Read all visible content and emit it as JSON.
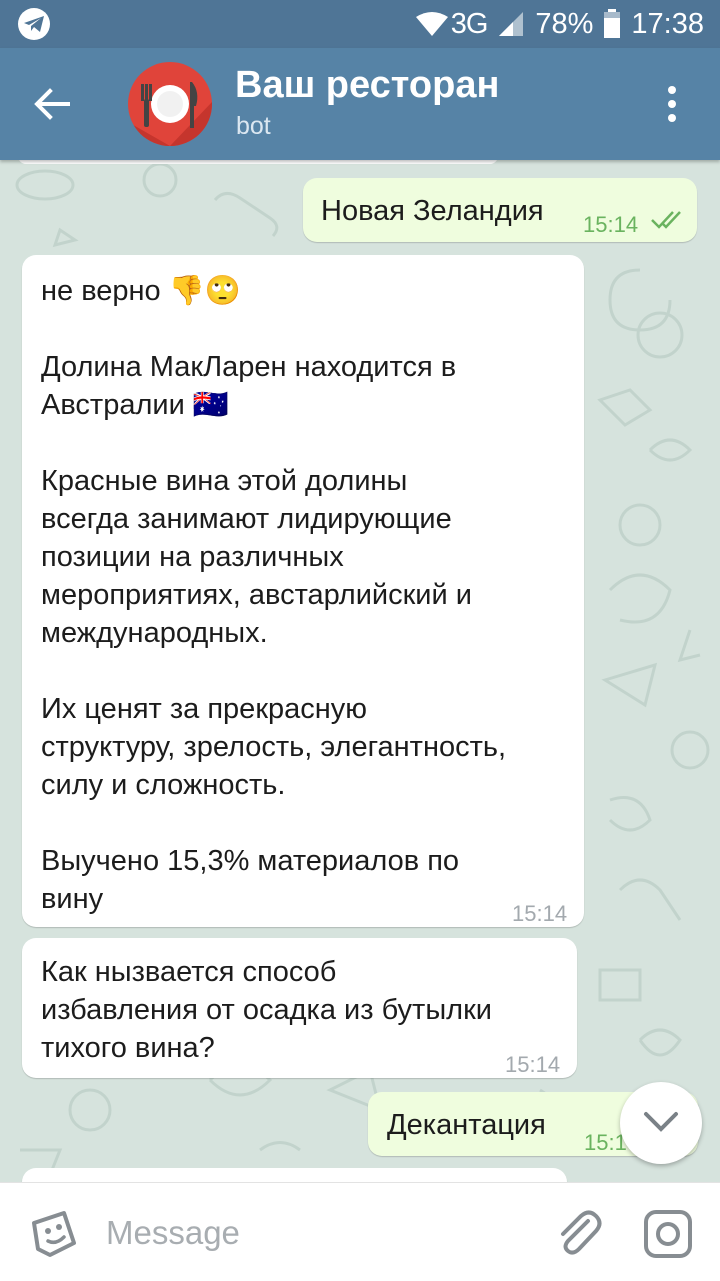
{
  "status_bar": {
    "network": "3G",
    "battery": "78%",
    "time": "17:38"
  },
  "header": {
    "title": "Ваш ресторан",
    "subtitle": "bot"
  },
  "messages": [
    {
      "direction": "out",
      "text": "Новая Зеландия",
      "time": "15:14"
    },
    {
      "direction": "in",
      "paragraphs": [
        "не верно 👎🙄",
        "Долина МакЛарен находится в\nАвстралии 🇦🇺",
        "Красные вина этой долины\nвсегда занимают лидирующие\nпозиции на различных\nмероприятиях, австарлийский и\nмеждународных.",
        "Их ценят за прекрасную\nструктуру, зрелость, элегантность,\nсилу и сложность.",
        "Выучено 15,3% материалов по\nвину"
      ],
      "time": "15:14"
    },
    {
      "direction": "in",
      "paragraphs": [
        "Как ныз­вается способ\nизбавления от осадка из бутылки\nтихого вина?"
      ],
      "time": "15:14"
    },
    {
      "direction": "out",
      "text": "Декантация",
      "time": "15:14"
    }
  ],
  "input": {
    "placeholder": "Message"
  },
  "icons": {
    "status_app": "telegram-icon",
    "back": "arrow-left-icon",
    "menu": "more-vert-icon",
    "emoji": "sticker-icon",
    "attach": "paperclip-icon",
    "camera": "camera-icon",
    "scroll_down": "chevron-down-icon",
    "read_receipt": "double-check-icon"
  },
  "colors": {
    "header": "#5683a6",
    "status_bar": "#4f7596",
    "outgoing_bubble": "#effdde",
    "incoming_bubble": "#ffffff",
    "outgoing_time": "#6ab35f"
  }
}
